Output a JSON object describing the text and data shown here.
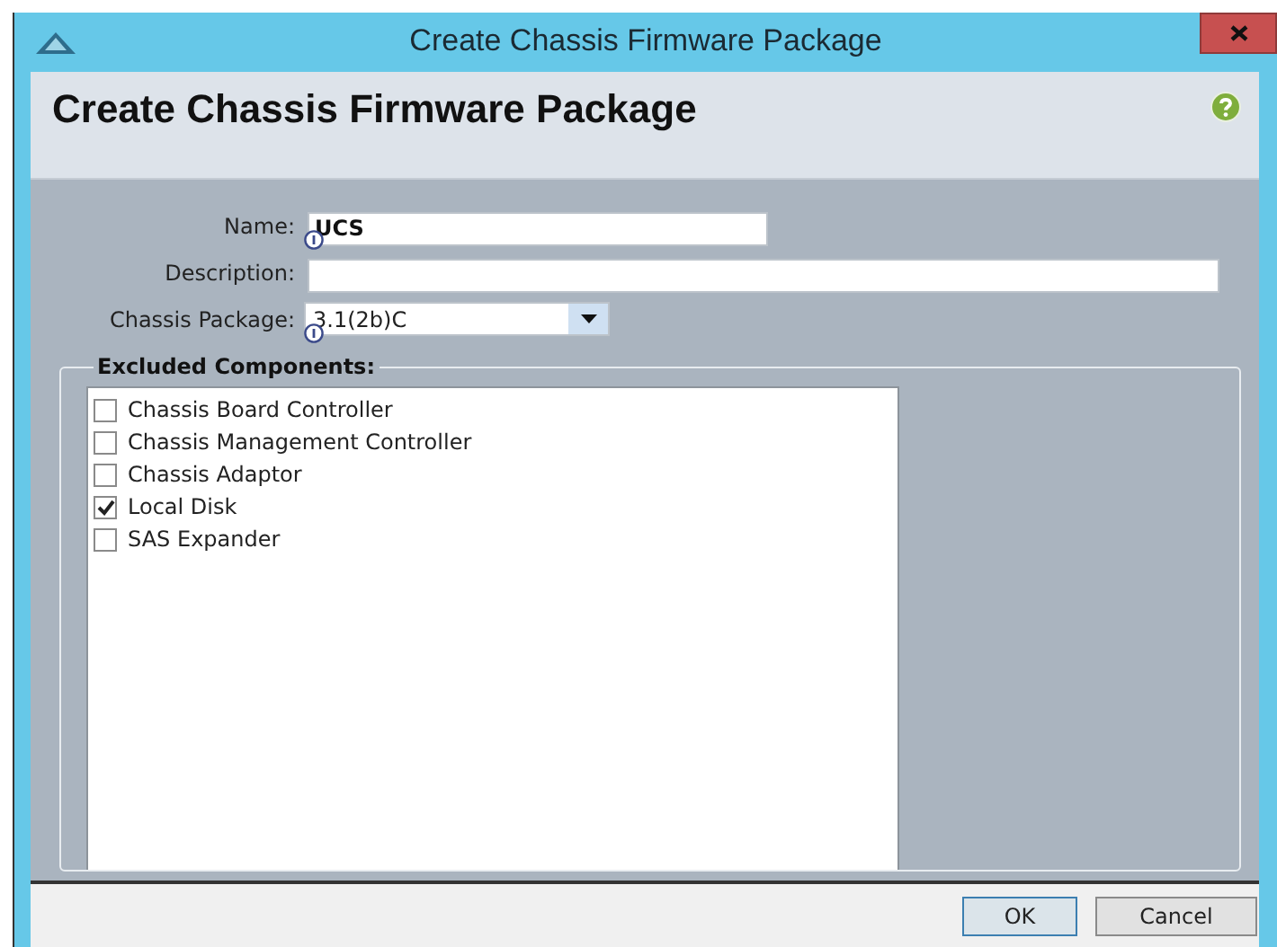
{
  "window": {
    "title": "Create Chassis Firmware Package"
  },
  "header": {
    "title": "Create Chassis Firmware Package"
  },
  "fields": [
    {
      "kind": "text",
      "label": "Name:",
      "value": "UCS",
      "info": true
    },
    {
      "kind": "text",
      "label": "Description:",
      "info": false
    },
    {
      "kind": "dropdown",
      "label": "Chassis Package:",
      "value": "3.1(2b)C",
      "info": true
    }
  ],
  "excluded_components": {
    "title": "Excluded Components:",
    "items": [
      {
        "label": "Chassis Board Controller",
        "checked": false
      },
      {
        "label": "Chassis Management Controller",
        "checked": false
      },
      {
        "label": "Chassis Adaptor",
        "checked": false
      },
      {
        "label": "Local Disk",
        "checked": true
      },
      {
        "label": "SAS Expander",
        "checked": false
      }
    ]
  },
  "buttons": [
    {
      "label": "OK",
      "default": true
    },
    {
      "label": "Cancel",
      "default": false
    }
  ]
}
